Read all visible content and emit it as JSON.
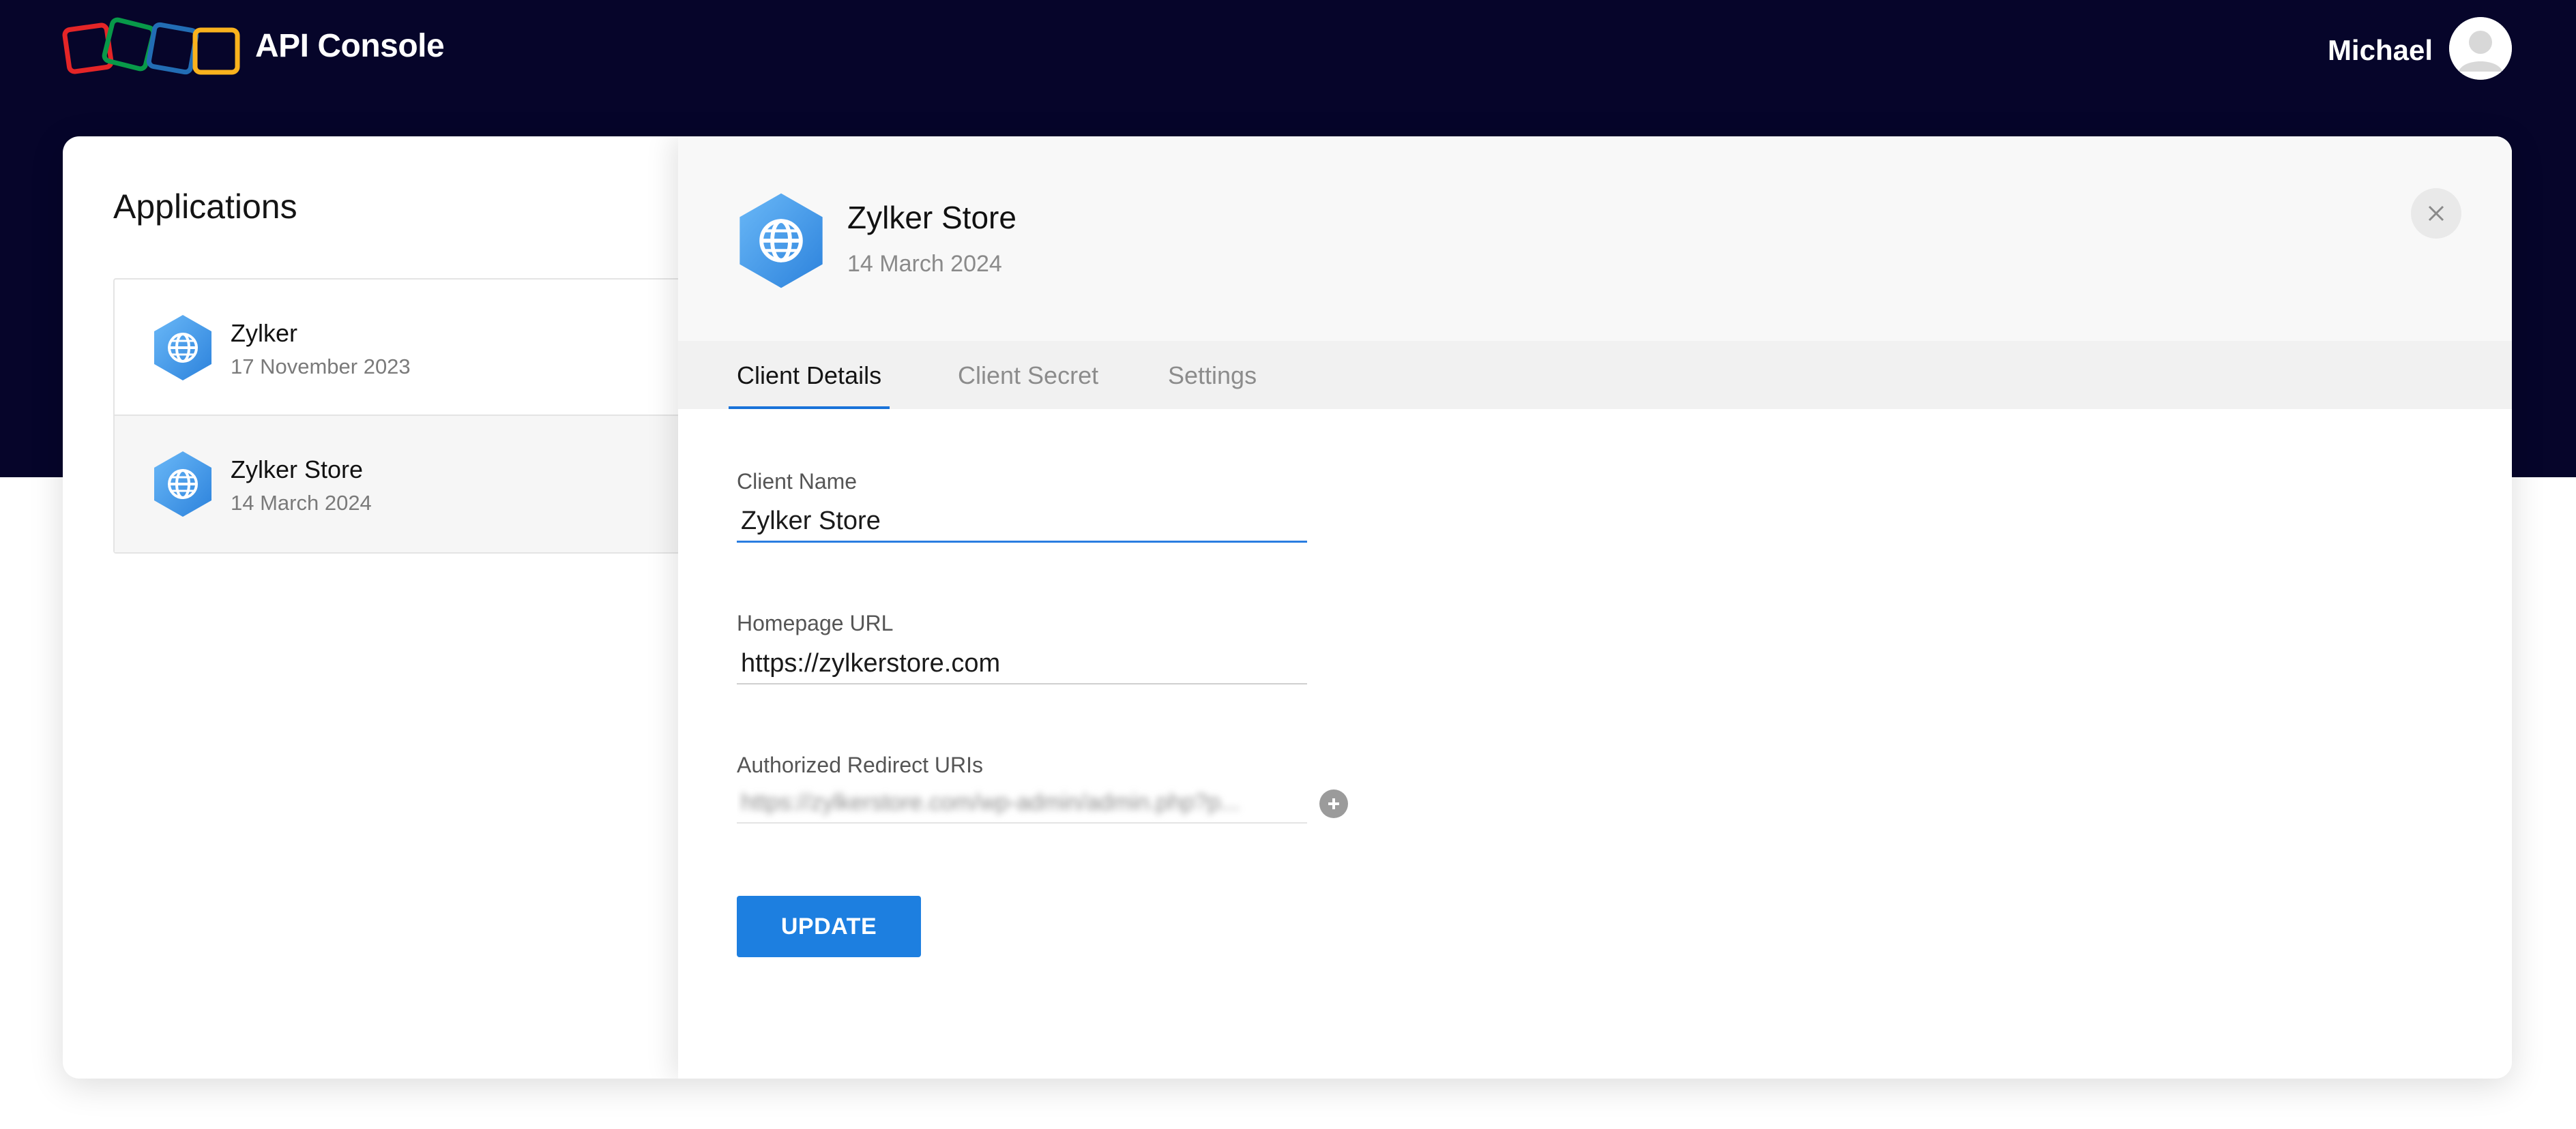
{
  "header": {
    "title": "API Console",
    "user_name": "Michael",
    "logo_icon": "zoho-logo-icon",
    "avatar_icon": "user-avatar-icon"
  },
  "applications": {
    "heading": "Applications",
    "items": [
      {
        "name": "Zylker",
        "date": "17 November 2023",
        "icon": "globe-icon"
      },
      {
        "name": "Zylker Store",
        "date": "14 March 2024",
        "icon": "globe-icon",
        "selected": true
      }
    ]
  },
  "detail": {
    "title": "Zylker Store",
    "date": "14 March 2024",
    "close_icon": "close-icon",
    "tabs": [
      {
        "label": "Client Details",
        "active": true
      },
      {
        "label": "Client Secret",
        "active": false
      },
      {
        "label": "Settings",
        "active": false
      }
    ],
    "fields": {
      "client_name": {
        "label": "Client Name",
        "value": "Zylker Store"
      },
      "homepage_url": {
        "label": "Homepage URL",
        "value": "https://zylkerstore.com"
      },
      "redirect_uris": {
        "label": "Authorized Redirect URIs",
        "value": "https://zylkerstore.com/wp-admin/admin.php?p..."
      }
    },
    "update_label": "UPDATE"
  },
  "colors": {
    "header_bg": "#06052a",
    "accent": "#1d7fe0",
    "icon_gradient_start": "#6ab8f7",
    "icon_gradient_end": "#2c82dc"
  }
}
